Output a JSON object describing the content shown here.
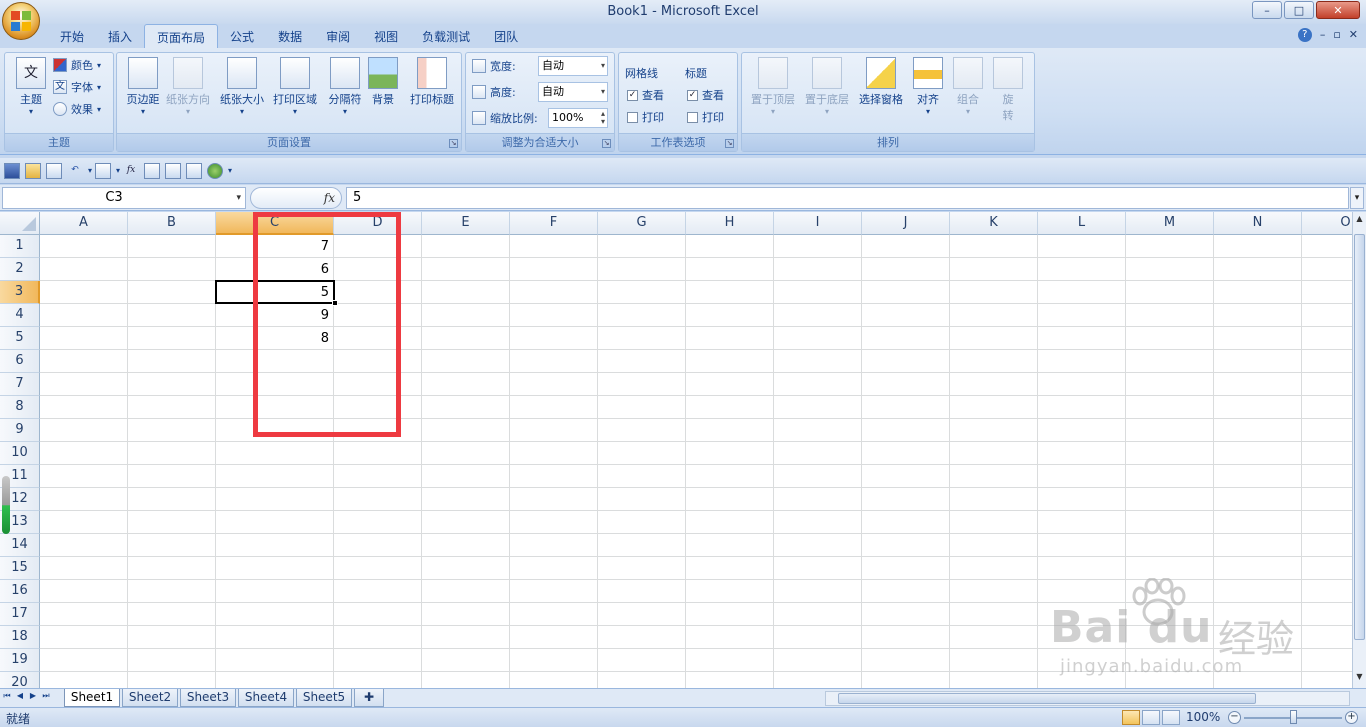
{
  "window": {
    "title": "Book1 - Microsoft Excel",
    "controls": [
      "–",
      "□",
      "✕"
    ]
  },
  "tabs": [
    "开始",
    "插入",
    "页面布局",
    "公式",
    "数据",
    "审阅",
    "视图",
    "负载测试",
    "团队"
  ],
  "active_tab": "页面布局",
  "ribbon": {
    "theme_group": {
      "label": "主题",
      "big": "主题",
      "small": [
        "颜色",
        "字体",
        "效果"
      ]
    },
    "page_setup_group": {
      "label": "页面设置",
      "buttons": [
        "页边距",
        "纸张方向",
        "纸张大小",
        "打印区域",
        "分隔符",
        "背景",
        "打印标题"
      ]
    },
    "scale_group": {
      "label": "调整为合适大小",
      "width_label": "宽度:",
      "width_value": "自动",
      "height_label": "高度:",
      "height_value": "自动",
      "scale_label": "缩放比例:",
      "scale_value": "100%"
    },
    "sheet_options_group": {
      "label": "工作表选项",
      "gridlines": "网格线",
      "headings": "标题",
      "view": "查看",
      "print": "打印"
    },
    "arrange_group": {
      "label": "排列",
      "buttons": [
        "置于顶层",
        "置于底层",
        "选择窗格",
        "对齐",
        "组合",
        "旋转"
      ]
    }
  },
  "formula_bar": {
    "name_box": "C3",
    "fx": "fx",
    "formula": "5"
  },
  "grid": {
    "columns": [
      "A",
      "B",
      "C",
      "D",
      "E",
      "F",
      "G",
      "H",
      "I",
      "J",
      "K",
      "L",
      "M",
      "N",
      "O"
    ],
    "rows": [
      "1",
      "2",
      "3",
      "4",
      "5",
      "6",
      "7",
      "8",
      "9",
      "10",
      "11",
      "12",
      "13",
      "14",
      "15",
      "16",
      "17",
      "18",
      "19",
      "20"
    ],
    "selected_column": "C",
    "selected_row": "3",
    "column_c_values": [
      "7",
      "6",
      "5",
      "9",
      "8"
    ]
  },
  "sheets": [
    "Sheet1",
    "Sheet2",
    "Sheet3",
    "Sheet4",
    "Sheet5"
  ],
  "active_sheet": "Sheet1",
  "status": {
    "text": "就绪",
    "zoom": "100%"
  },
  "watermark": {
    "brand": "Bai du",
    "cn": "经验",
    "url": "jingyan.baidu.com"
  },
  "colors": {
    "highlight_box": "#ee3a41",
    "selected_header": "#f1b85c"
  }
}
